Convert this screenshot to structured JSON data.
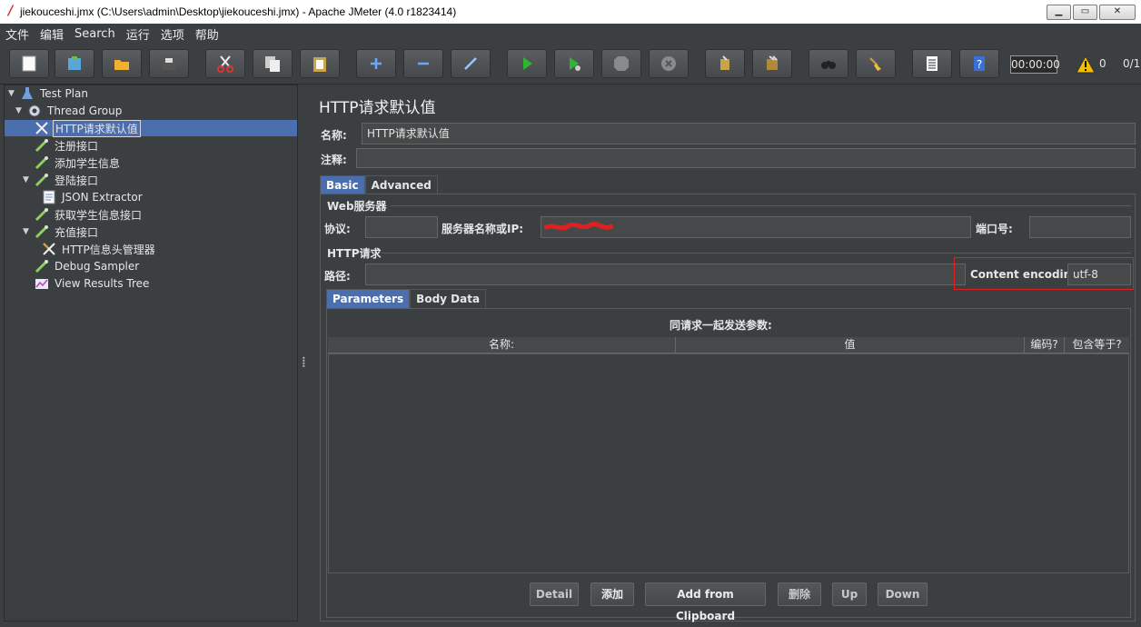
{
  "window": {
    "title": "jiekouceshi.jmx (C:\\Users\\admin\\Desktop\\jiekouceshi.jmx) - Apache JMeter (4.0 r1823414)"
  },
  "menu": [
    "文件",
    "编辑",
    "Search",
    "运行",
    "选项",
    "帮助"
  ],
  "toolbar": {
    "timer": "00:00:00",
    "warning_count": "0",
    "threads": "0/1"
  },
  "tree": {
    "test_plan": "Test Plan",
    "thread_group": "Thread Group",
    "http_defaults": "HTTP请求默认值",
    "register": "注册接口",
    "add_student": "添加学生信息",
    "login": "登陆接口",
    "json_extractor": "JSON Extractor",
    "get_student": "获取学生信息接口",
    "recharge": "充值接口",
    "header_manager": "HTTP信息头管理器",
    "debug_sampler": "Debug Sampler",
    "results_tree": "View Results Tree"
  },
  "main": {
    "title": "HTTP请求默认值",
    "name_label": "名称:",
    "name_value": "HTTP请求默认值",
    "comment_label": "注释:",
    "comment_value": "",
    "tabs": [
      "Basic",
      "Advanced"
    ],
    "web_server": {
      "group_title": "Web服务器",
      "protocol_label": "协议:",
      "protocol_value": "",
      "server_label": "服务器名称或IP:",
      "port_label": "端口号:",
      "port_value": ""
    },
    "http_request": {
      "group_title": "HTTP请求",
      "path_label": "路径:",
      "path_value": "",
      "encoding_label": "Content encoding:",
      "encoding_value": "utf-8"
    },
    "param_tabs": [
      "Parameters",
      "Body Data"
    ],
    "params_title": "同请求一起发送参数:",
    "columns": [
      "名称:",
      "值",
      "编码?",
      "包含等于?"
    ],
    "buttons": {
      "detail": "Detail",
      "add": "添加",
      "add_clipboard": "Add from Clipboard",
      "delete": "删除",
      "up": "Up",
      "down": "Down"
    }
  },
  "colors": {
    "background": "#3c3f41",
    "selection": "#4b6eaf",
    "highlight_box": "#e02020"
  }
}
